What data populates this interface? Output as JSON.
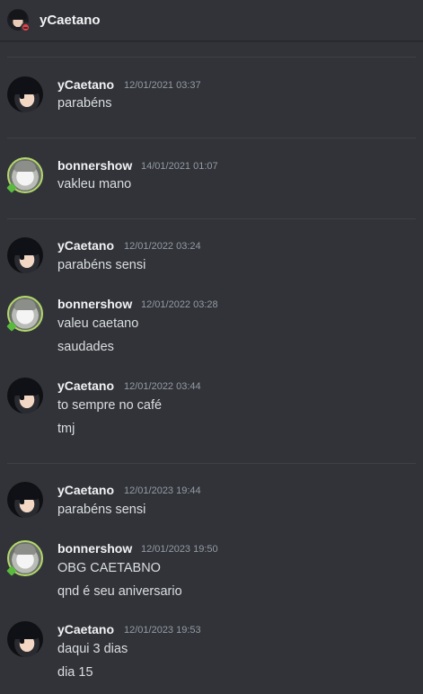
{
  "header": {
    "title": "yCaetano",
    "status": "do-not-disturb"
  },
  "messages": [
    {
      "author": "yCaetano",
      "avatar": "dark-haired-anime-avatar",
      "timestamp": "12/01/2021 03:37",
      "lines": [
        "parabéns"
      ]
    },
    {
      "author": "bonnershow",
      "avatar": "grey-haired-anime-avatar",
      "timestamp": "14/01/2021 01:07",
      "lines": [
        "vakleu mano"
      ]
    },
    {
      "author": "yCaetano",
      "avatar": "dark-haired-anime-avatar",
      "timestamp": "12/01/2022 03:24",
      "lines": [
        "parabéns sensi"
      ]
    },
    {
      "author": "bonnershow",
      "avatar": "grey-haired-anime-avatar",
      "timestamp": "12/01/2022 03:28",
      "lines": [
        "valeu caetano",
        "saudades"
      ]
    },
    {
      "author": "yCaetano",
      "avatar": "dark-haired-anime-avatar",
      "timestamp": "12/01/2022 03:44",
      "lines": [
        "to sempre no café",
        "tmj"
      ]
    },
    {
      "author": "yCaetano",
      "avatar": "dark-haired-anime-avatar",
      "timestamp": "12/01/2023 19:44",
      "lines": [
        "parabéns sensi"
      ]
    },
    {
      "author": "bonnershow",
      "avatar": "grey-haired-anime-avatar",
      "timestamp": "12/01/2023 19:50",
      "lines": [
        "OBG CAETABNO",
        "qnd é seu aniversario"
      ]
    },
    {
      "author": "yCaetano",
      "avatar": "dark-haired-anime-avatar",
      "timestamp": "12/01/2023 19:53",
      "lines": [
        "daqui 3 dias",
        "dia 15"
      ]
    }
  ],
  "colors": {
    "background": "#313338",
    "text": "#dbdee1",
    "author": "#f2f3f5",
    "timestamp": "#949ba4",
    "divider": "#3f4147",
    "dnd_badge": "#f23f43",
    "online_badge": "#5aba3e"
  }
}
